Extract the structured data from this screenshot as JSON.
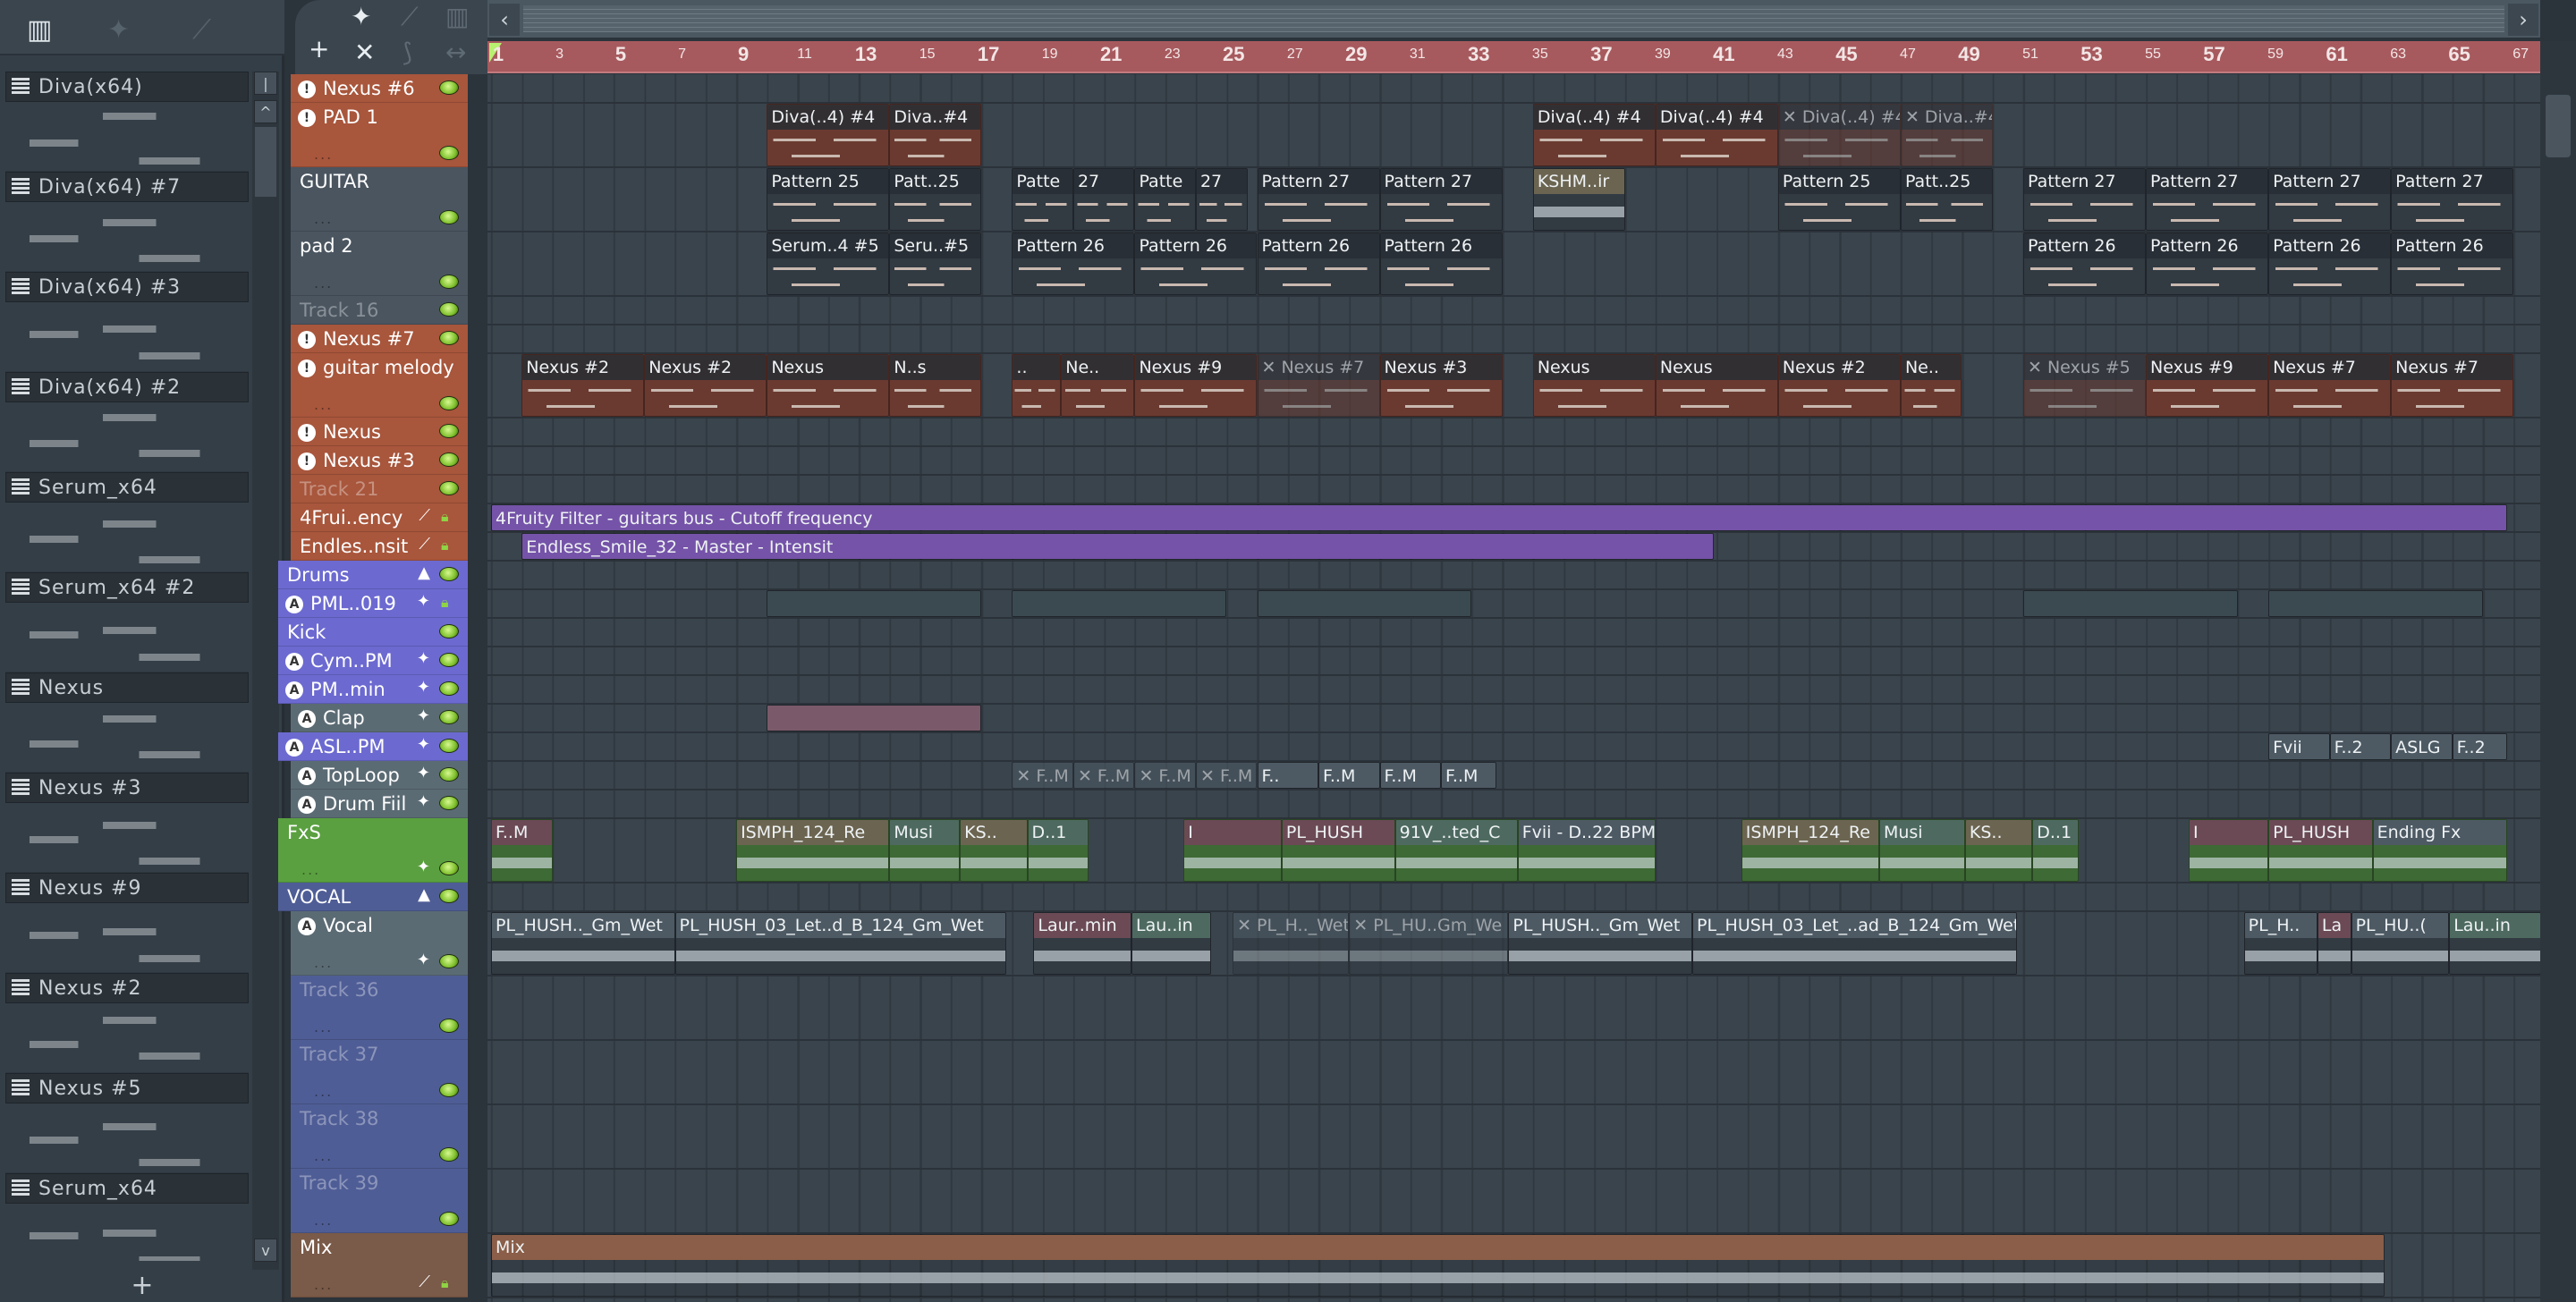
{
  "colors": {
    "orange": "#a8563c",
    "gray": "#4a5560",
    "purple": "#6c6ad0",
    "slate": "#5b6b74",
    "green": "#5aa040",
    "blue": "#4f5d96",
    "brown": "#7a5a48",
    "ruler": "#a75a5e"
  },
  "picker": {
    "add_label": "+",
    "items": [
      "Diva(x64)",
      "Diva(x64) #7",
      "Diva(x64) #3",
      "Diva(x64) #2",
      "Serum_x64",
      "Serum_x64 #2",
      "Nexus",
      "Nexus #3",
      "Nexus #9",
      "Nexus #2",
      "Nexus #5",
      "Serum_x64"
    ]
  },
  "toolbar": {
    "add": "+",
    "close": "✕"
  },
  "ruler": {
    "bars": [
      1,
      3,
      5,
      7,
      9,
      11,
      13,
      15,
      17,
      19,
      21,
      23,
      25,
      27,
      29,
      31,
      33,
      35,
      37,
      39,
      41,
      43,
      45,
      47,
      49,
      51,
      53,
      55,
      57,
      59,
      61,
      63,
      65,
      67
    ]
  },
  "tracks": [
    {
      "name": "Nexus #6",
      "color": "orange",
      "size": "S",
      "icon": "!",
      "led": "led"
    },
    {
      "name": "PAD 1",
      "color": "orange",
      "size": "T",
      "icon": "!",
      "led": "led"
    },
    {
      "name": "GUITAR",
      "color": "gray",
      "size": "T",
      "led": "led"
    },
    {
      "name": "pad 2",
      "color": "gray",
      "size": "T",
      "led": "led"
    },
    {
      "name": "Track 16",
      "color": "gray",
      "size": "S",
      "led": "led",
      "dim": true
    },
    {
      "name": "Nexus #7",
      "color": "orange",
      "size": "S",
      "icon": "!",
      "led": "led"
    },
    {
      "name": "guitar melody",
      "color": "orange",
      "size": "T",
      "icon": "!",
      "led": "led"
    },
    {
      "name": "Nexus",
      "color": "orange",
      "size": "S",
      "icon": "!",
      "led": "led"
    },
    {
      "name": "Nexus #3",
      "color": "orange",
      "size": "S",
      "icon": "!",
      "led": "led"
    },
    {
      "name": "Track 21",
      "color": "orange",
      "size": "S",
      "led": "led",
      "dim": true
    },
    {
      "name": "4Frui..ency",
      "color": "orange",
      "size": "S",
      "led": "lock",
      "extra": "automation"
    },
    {
      "name": "Endles..nsit",
      "color": "orange",
      "size": "S",
      "led": "lock",
      "extra": "automation"
    },
    {
      "name": "Drums",
      "color": "purple",
      "size": "S",
      "led": "led",
      "extra": "collapse"
    },
    {
      "name": "PML..019",
      "color": "purple",
      "size": "S",
      "icon": "A",
      "led": "lock",
      "extra": "wave"
    },
    {
      "name": "Kick",
      "color": "purple",
      "size": "S",
      "led": "led"
    },
    {
      "name": "Cym..PM",
      "color": "purple",
      "size": "S",
      "icon": "A",
      "led": "led",
      "extra": "wave"
    },
    {
      "name": "PM..min",
      "color": "purple",
      "size": "S",
      "icon": "A",
      "led": "led",
      "extra": "wave"
    },
    {
      "name": "Clap",
      "color": "slate",
      "size": "S",
      "icon": "A",
      "led": "led",
      "extra": "wave"
    },
    {
      "name": "ASL..PM",
      "color": "purple",
      "size": "S",
      "icon": "A",
      "led": "led",
      "extra": "wave"
    },
    {
      "name": "TopLoop",
      "color": "slate",
      "size": "S",
      "icon": "A",
      "led": "led",
      "extra": "wave"
    },
    {
      "name": "Drum Fiil",
      "color": "slate",
      "size": "S",
      "icon": "A",
      "led": "led",
      "extra": "wave"
    },
    {
      "name": "FxS",
      "color": "green",
      "size": "T",
      "led": "led",
      "extra": "wave"
    },
    {
      "name": "VOCAL",
      "color": "blue",
      "size": "S",
      "led": "led",
      "extra": "collapse"
    },
    {
      "name": "Vocal",
      "color": "slate",
      "size": "T",
      "icon": "A",
      "led": "led",
      "extra": "wave"
    },
    {
      "name": "Track 36",
      "color": "blue",
      "size": "T",
      "led": "led",
      "dim": true
    },
    {
      "name": "Track 37",
      "color": "blue",
      "size": "T",
      "led": "led",
      "dim": true
    },
    {
      "name": "Track 38",
      "color": "blue",
      "size": "T",
      "led": "led",
      "dim": true
    },
    {
      "name": "Track 39",
      "color": "blue",
      "size": "T",
      "led": "led",
      "dim": true
    },
    {
      "name": "Mix",
      "color": "brown",
      "size": "T",
      "led": "lock",
      "extra": "automation"
    }
  ],
  "clips": [
    {
      "t": 1,
      "s": 10,
      "l": 4,
      "label": "Diva(..4) #4",
      "k": "p",
      "b": "#6a3a30"
    },
    {
      "t": 1,
      "s": 14,
      "l": 3,
      "label": "Diva..#4",
      "k": "p",
      "b": "#6a3a30"
    },
    {
      "t": 1,
      "s": 35,
      "l": 4,
      "label": "Diva(..4) #4",
      "k": "p",
      "b": "#6a3a30"
    },
    {
      "t": 1,
      "s": 39,
      "l": 4,
      "label": "Diva(..4) #4",
      "k": "p",
      "b": "#6a3a30"
    },
    {
      "t": 1,
      "s": 43,
      "l": 4,
      "label": "Diva(..4) #4",
      "k": "p",
      "b": "#6a3a30",
      "m": true
    },
    {
      "t": 1,
      "s": 47,
      "l": 3,
      "label": "Diva..#4",
      "k": "p",
      "b": "#6a3a30",
      "m": true
    },
    {
      "t": 2,
      "s": 10,
      "l": 4,
      "label": "Pattern 25",
      "k": "p"
    },
    {
      "t": 2,
      "s": 14,
      "l": 3,
      "label": "Patt..25",
      "k": "p"
    },
    {
      "t": 2,
      "s": 18,
      "l": 2,
      "label": "Patte",
      "k": "p"
    },
    {
      "t": 2,
      "s": 20,
      "l": 2,
      "label": "27",
      "k": "p"
    },
    {
      "t": 2,
      "s": 22,
      "l": 2,
      "label": "Patte",
      "k": "p"
    },
    {
      "t": 2,
      "s": 24,
      "l": 1.7,
      "label": "27",
      "k": "p"
    },
    {
      "t": 2,
      "s": 26,
      "l": 4,
      "label": "Pattern 27",
      "k": "p"
    },
    {
      "t": 2,
      "s": 30,
      "l": 4,
      "label": "Pattern 27",
      "k": "p"
    },
    {
      "t": 2,
      "s": 35,
      "l": 3,
      "label": "KSHM..ir",
      "k": "a",
      "h": "#6b6450"
    },
    {
      "t": 2,
      "s": 43,
      "l": 4,
      "label": "Pattern 25",
      "k": "p"
    },
    {
      "t": 2,
      "s": 47,
      "l": 3,
      "label": "Patt..25",
      "k": "p"
    },
    {
      "t": 2,
      "s": 51,
      "l": 4,
      "label": "Pattern 27",
      "k": "p"
    },
    {
      "t": 2,
      "s": 55,
      "l": 4,
      "label": "Pattern 27",
      "k": "p"
    },
    {
      "t": 2,
      "s": 59,
      "l": 4,
      "label": "Pattern 27",
      "k": "p"
    },
    {
      "t": 2,
      "s": 63,
      "l": 4,
      "label": "Pattern 27",
      "k": "p"
    },
    {
      "t": 3,
      "s": 10,
      "l": 4,
      "label": "Serum..4 #5",
      "k": "p"
    },
    {
      "t": 3,
      "s": 14,
      "l": 3,
      "label": "Seru..#5",
      "k": "p"
    },
    {
      "t": 3,
      "s": 18,
      "l": 4,
      "label": "Pattern 26",
      "k": "p"
    },
    {
      "t": 3,
      "s": 22,
      "l": 4,
      "label": "Pattern 26",
      "k": "p"
    },
    {
      "t": 3,
      "s": 26,
      "l": 4,
      "label": "Pattern 26",
      "k": "p"
    },
    {
      "t": 3,
      "s": 30,
      "l": 4,
      "label": "Pattern 26",
      "k": "p"
    },
    {
      "t": 3,
      "s": 51,
      "l": 4,
      "label": "Pattern 26",
      "k": "p"
    },
    {
      "t": 3,
      "s": 55,
      "l": 4,
      "label": "Pattern 26",
      "k": "p"
    },
    {
      "t": 3,
      "s": 59,
      "l": 4,
      "label": "Pattern 26",
      "k": "p"
    },
    {
      "t": 3,
      "s": 63,
      "l": 4,
      "label": "Pattern 26",
      "k": "p"
    },
    {
      "t": 6,
      "s": 2,
      "l": 4,
      "label": "Nexus #2",
      "k": "p",
      "b": "#6a3a30"
    },
    {
      "t": 6,
      "s": 6,
      "l": 4,
      "label": "Nexus #2",
      "k": "p",
      "b": "#6a3a30"
    },
    {
      "t": 6,
      "s": 10,
      "l": 4,
      "label": "Nexus",
      "k": "p",
      "b": "#6a3a30"
    },
    {
      "t": 6,
      "s": 14,
      "l": 3,
      "label": "N..s",
      "k": "p",
      "b": "#6a3a30"
    },
    {
      "t": 6,
      "s": 18,
      "l": 1.6,
      "label": "..",
      "k": "p",
      "b": "#6a3a30"
    },
    {
      "t": 6,
      "s": 19.6,
      "l": 2.4,
      "label": "Ne..",
      "k": "p",
      "b": "#6a3a30"
    },
    {
      "t": 6,
      "s": 22,
      "l": 4,
      "label": "Nexus #9",
      "k": "p",
      "b": "#6a3a30"
    },
    {
      "t": 6,
      "s": 26,
      "l": 4,
      "label": "Nexus #7",
      "k": "p",
      "b": "#6a3a30",
      "m": true
    },
    {
      "t": 6,
      "s": 30,
      "l": 4,
      "label": "Nexus #3",
      "k": "p",
      "b": "#6a3a30"
    },
    {
      "t": 6,
      "s": 35,
      "l": 4,
      "label": "Nexus",
      "k": "p",
      "b": "#6a3a30"
    },
    {
      "t": 6,
      "s": 39,
      "l": 4,
      "label": "Nexus",
      "k": "p",
      "b": "#6a3a30"
    },
    {
      "t": 6,
      "s": 43,
      "l": 4,
      "label": "Nexus #2",
      "k": "p",
      "b": "#6a3a30"
    },
    {
      "t": 6,
      "s": 47,
      "l": 2,
      "label": "Ne..",
      "k": "p",
      "b": "#6a3a30"
    },
    {
      "t": 6,
      "s": 51,
      "l": 4,
      "label": "Nexus #5",
      "k": "p",
      "b": "#6a3a30",
      "m": true
    },
    {
      "t": 6,
      "s": 55,
      "l": 4,
      "label": "Nexus #9",
      "k": "p",
      "b": "#6a3a30"
    },
    {
      "t": 6,
      "s": 59,
      "l": 4,
      "label": "Nexus #7",
      "k": "p",
      "b": "#6a3a30"
    },
    {
      "t": 6,
      "s": 63,
      "l": 4,
      "label": "Nexus #7",
      "k": "p",
      "b": "#6a3a30"
    },
    {
      "t": 10,
      "s": 1,
      "l": 65.8,
      "label": "4Fruity Filter - guitars bus - Cutoff frequency",
      "k": "auto",
      "h": "#7553a8"
    },
    {
      "t": 11,
      "s": 2,
      "l": 38.9,
      "label": "Endless_Smile_32 - Master - Intensit",
      "k": "auto",
      "h": "#7553a8"
    },
    {
      "t": 13,
      "s": 10,
      "l": 7,
      "label": "",
      "k": "a",
      "h": "#3b4a50"
    },
    {
      "t": 13,
      "s": 18,
      "l": 7,
      "label": "",
      "k": "a",
      "h": "#3b4a50"
    },
    {
      "t": 13,
      "s": 26,
      "l": 7,
      "label": "",
      "k": "a",
      "h": "#3b4a50"
    },
    {
      "t": 13,
      "s": 51,
      "l": 7,
      "label": "",
      "k": "a",
      "h": "#3b4a50"
    },
    {
      "t": 13,
      "s": 59,
      "l": 7,
      "label": "",
      "k": "a",
      "h": "#3b4a50"
    },
    {
      "t": 17,
      "s": 10,
      "l": 7,
      "label": "",
      "k": "a",
      "h": "#7a5a6a"
    },
    {
      "t": 19,
      "s": 18,
      "l": 2,
      "label": "F..M",
      "k": "a",
      "m": true,
      "h": "#4d5a64"
    },
    {
      "t": 19,
      "s": 20,
      "l": 2,
      "label": "F..M",
      "k": "a",
      "m": true,
      "h": "#4d5a64"
    },
    {
      "t": 19,
      "s": 22,
      "l": 2,
      "label": "F..M",
      "k": "a",
      "m": true,
      "h": "#4d5a64"
    },
    {
      "t": 19,
      "s": 24,
      "l": 2,
      "label": "F..M",
      "k": "a",
      "m": true,
      "h": "#4d5a64"
    },
    {
      "t": 19,
      "s": 26,
      "l": 2,
      "label": "F..",
      "k": "a",
      "h": "#4d5a64"
    },
    {
      "t": 19,
      "s": 28,
      "l": 2,
      "label": "F..M",
      "k": "a",
      "h": "#4d5a64"
    },
    {
      "t": 19,
      "s": 30,
      "l": 2,
      "label": "F..M",
      "k": "a",
      "h": "#4d5a64"
    },
    {
      "t": 19,
      "s": 32,
      "l": 1.8,
      "label": "F..M",
      "k": "a",
      "h": "#4d5a64"
    },
    {
      "t": 18,
      "s": 59,
      "l": 2,
      "label": "Fvii",
      "k": "a",
      "h": "#4d5a64"
    },
    {
      "t": 18,
      "s": 61,
      "l": 2,
      "label": "F..2",
      "k": "a",
      "h": "#4d5a64"
    },
    {
      "t": 18,
      "s": 63,
      "l": 2,
      "label": "ASLG",
      "k": "a",
      "h": "#4d5a64"
    },
    {
      "t": 18,
      "s": 65,
      "l": 1.8,
      "label": "F..2",
      "k": "a",
      "h": "#4d5a64"
    },
    {
      "t": 21,
      "s": 1,
      "l": 2,
      "label": "F..M",
      "k": "a",
      "h": "#6b4a55",
      "b": "#3e6a35"
    },
    {
      "t": 21,
      "s": 9,
      "l": 5,
      "label": "ISMPH_124_Re",
      "k": "a",
      "h": "#6b6450",
      "b": "#3e6a35"
    },
    {
      "t": 21,
      "s": 14,
      "l": 2.3,
      "label": "Musi",
      "k": "a",
      "h": "#4e6a60",
      "b": "#3e6a35"
    },
    {
      "t": 21,
      "s": 16.3,
      "l": 2.2,
      "label": "KS..",
      "k": "a",
      "h": "#6b6450",
      "b": "#3e6a35"
    },
    {
      "t": 21,
      "s": 18.5,
      "l": 2,
      "label": "D..1",
      "k": "a",
      "h": "#4e6a60",
      "b": "#3e6a35"
    },
    {
      "t": 21,
      "s": 23.6,
      "l": 3.2,
      "label": "I",
      "k": "a",
      "h": "#6b4a55",
      "b": "#3e6a35"
    },
    {
      "t": 21,
      "s": 26.8,
      "l": 3.7,
      "label": "PL_HUSH",
      "k": "a",
      "h": "#6b4a55",
      "b": "#3e6a35"
    },
    {
      "t": 21,
      "s": 30.5,
      "l": 4,
      "label": "91V_..ted_C",
      "k": "a",
      "h": "#4e6a60",
      "b": "#3e6a35"
    },
    {
      "t": 21,
      "s": 34.5,
      "l": 4.5,
      "label": "Fvii - D..22 BPM",
      "k": "a",
      "h": "#4d5a64",
      "b": "#3e6a35"
    },
    {
      "t": 21,
      "s": 41.8,
      "l": 4.5,
      "label": "ISMPH_124_Re",
      "k": "a",
      "h": "#6b6450",
      "b": "#3e6a35"
    },
    {
      "t": 21,
      "s": 46.3,
      "l": 2.8,
      "label": "Musi",
      "k": "a",
      "h": "#4e6a60",
      "b": "#3e6a35"
    },
    {
      "t": 21,
      "s": 49.1,
      "l": 2.2,
      "label": "KS..",
      "k": "a",
      "h": "#6b6450",
      "b": "#3e6a35"
    },
    {
      "t": 21,
      "s": 51.3,
      "l": 1.5,
      "label": "D..1",
      "k": "a",
      "h": "#4e6a60",
      "b": "#3e6a35"
    },
    {
      "t": 21,
      "s": 56.4,
      "l": 2.6,
      "label": "I",
      "k": "a",
      "h": "#6b4a55",
      "b": "#3e6a35"
    },
    {
      "t": 21,
      "s": 59,
      "l": 3.4,
      "label": "PL_HUSH",
      "k": "a",
      "h": "#6b4a55",
      "b": "#3e6a35"
    },
    {
      "t": 21,
      "s": 62.4,
      "l": 4.4,
      "label": "Ending Fx",
      "k": "a",
      "h": "#4d5a64",
      "b": "#3e6a35"
    },
    {
      "t": 23,
      "s": 1,
      "l": 6,
      "label": "PL_HUSH.._Gm_Wet",
      "k": "a",
      "h": "#4d5a64"
    },
    {
      "t": 23,
      "s": 7,
      "l": 10.8,
      "label": "PL_HUSH_03_Let..d_B_124_Gm_Wet",
      "k": "a",
      "h": "#4d5a64"
    },
    {
      "t": 23,
      "s": 18.7,
      "l": 3.2,
      "label": "Laur..min",
      "k": "a",
      "h": "#6b4a55"
    },
    {
      "t": 23,
      "s": 21.9,
      "l": 2.6,
      "label": "Lau..in",
      "k": "a",
      "h": "#4e6a60"
    },
    {
      "t": 23,
      "s": 25.2,
      "l": 3.8,
      "label": "PL_H.._Wet",
      "k": "a",
      "h": "#4d5a64",
      "m": true
    },
    {
      "t": 23,
      "s": 29,
      "l": 5.2,
      "label": "PL_HU..Gm_We",
      "k": "a",
      "h": "#4d5a64",
      "m": true
    },
    {
      "t": 23,
      "s": 34.2,
      "l": 6,
      "label": "PL_HUSH.._Gm_Wet",
      "k": "a",
      "h": "#4d5a64"
    },
    {
      "t": 23,
      "s": 40.2,
      "l": 10.6,
      "label": "PL_HUSH_03_Let_..ad_B_124_Gm_Wet",
      "k": "a",
      "h": "#4d5a64"
    },
    {
      "t": 23,
      "s": 58.2,
      "l": 2.4,
      "label": "PL_H..",
      "k": "a",
      "h": "#4d5a64"
    },
    {
      "t": 23,
      "s": 60.6,
      "l": 1.1,
      "label": "La",
      "k": "a",
      "h": "#6b4a55"
    },
    {
      "t": 23,
      "s": 61.7,
      "l": 3.2,
      "label": "PL_HU..(",
      "k": "a",
      "h": "#4d5a64"
    },
    {
      "t": 23,
      "s": 64.9,
      "l": 3,
      "label": "Lau..in",
      "k": "a",
      "h": "#4e6a60"
    },
    {
      "t": 28,
      "s": 1,
      "l": 61.8,
      "label": "Mix",
      "k": "auto",
      "h": "#8a5e48"
    }
  ]
}
